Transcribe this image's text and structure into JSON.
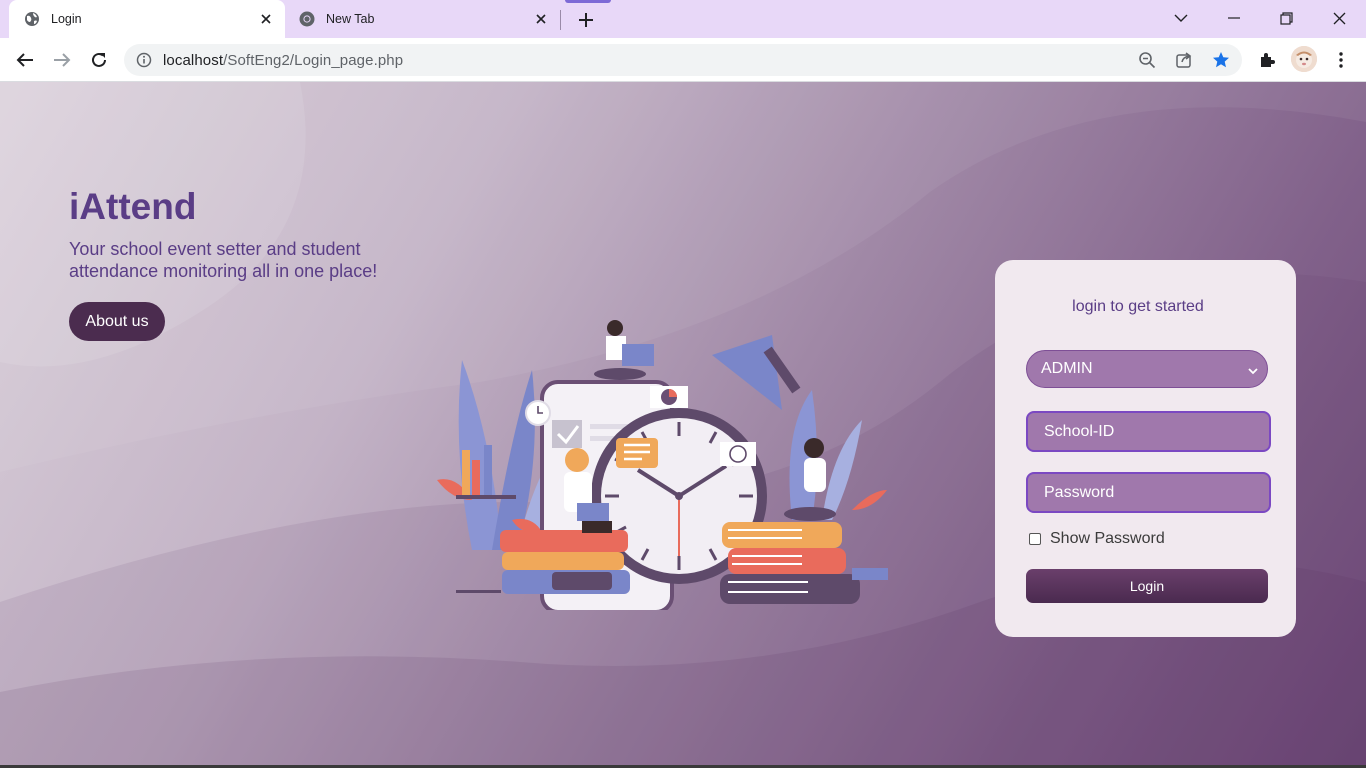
{
  "browser": {
    "tabs": [
      {
        "title": "Login",
        "favicon": "globe-icon",
        "active": true
      },
      {
        "title": "New Tab",
        "favicon": "chrome-icon",
        "active": false
      }
    ],
    "url_host": "localhost",
    "url_path": "/SoftEng2/Login_page.php",
    "colors": {
      "tabstrip": "#e8d8f8",
      "omnibox": "#f1f3f4",
      "bookmark_star": "#1a73e8"
    }
  },
  "page": {
    "brand": "iAttend",
    "tagline": "Your school event setter and student attendance monitoring all in one place!",
    "about_button": "About us",
    "colors": {
      "brand_text": "#5a3d86",
      "background_start": "#d9cfd9",
      "background_end": "#6e4a78",
      "about_button": "#4b2c4f"
    }
  },
  "login": {
    "heading": "login to get started",
    "role_selected": "ADMIN",
    "school_id_placeholder": "School-ID",
    "password_placeholder": "Password",
    "show_password_label": "Show Password",
    "show_password_checked": false,
    "login_button": "Login",
    "colors": {
      "card": "#f1e9ef",
      "field": "#a078ac",
      "field_border": "#7b48c2",
      "button": "#4a2a4f"
    }
  }
}
